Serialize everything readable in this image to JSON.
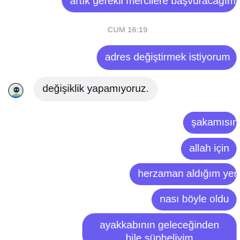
{
  "conversation": {
    "timestamp": "CUM 16:19",
    "messages": [
      {
        "id": "m0",
        "direction": "outgoing",
        "text": "artık gerekli mercilere başvuracağım"
      },
      {
        "id": "m1",
        "direction": "outgoing",
        "text": "adres değiştirmek istiyorum"
      },
      {
        "id": "m2",
        "direction": "incoming",
        "text": "değişiklik yapamıyoruz."
      },
      {
        "id": "m3",
        "direction": "outgoing",
        "text": "şakamısınız"
      },
      {
        "id": "m4",
        "direction": "outgoing",
        "text": "allah için"
      },
      {
        "id": "m5",
        "direction": "outgoing",
        "text": "herzaman aldığım yer"
      },
      {
        "id": "m6",
        "direction": "outgoing",
        "text": "nası böyle oldu"
      },
      {
        "id": "m7",
        "direction": "outgoing",
        "text": "ayakkabının geleceğinden bile şüpheliyim"
      }
    ]
  },
  "colors": {
    "outgoing_bubble": "#6b5cf0",
    "incoming_bubble": "#f1f1f3",
    "timestamp_text": "#8a8a8f"
  },
  "icons": {
    "sender_avatar": "business-avatar-icon"
  }
}
